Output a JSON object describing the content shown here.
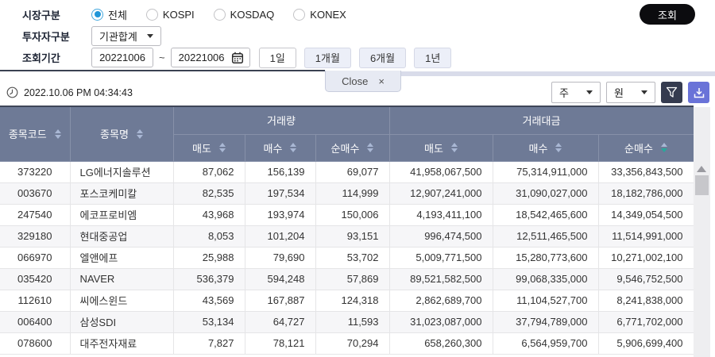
{
  "form": {
    "market": {
      "label": "시장구분",
      "options": [
        {
          "label": "전체",
          "selected": true
        },
        {
          "label": "KOSPI",
          "selected": false
        },
        {
          "label": "KOSDAQ",
          "selected": false
        },
        {
          "label": "KONEX",
          "selected": false
        }
      ]
    },
    "investor": {
      "label": "투자자구분",
      "value": "기관합계"
    },
    "period": {
      "label": "조회기간",
      "from": "20221006",
      "tilde": "~",
      "to": "20221006",
      "ranges": [
        "1일",
        "1개월",
        "6개월",
        "1년"
      ],
      "selected_range": "1일"
    },
    "search_button": "조회"
  },
  "tab": {
    "label": "Close",
    "close": "×"
  },
  "toolbar": {
    "timestamp": "2022.10.06 PM 04:34:43",
    "unit_period": "주",
    "unit_currency": "원"
  },
  "table": {
    "header": {
      "code": "종목코드",
      "name": "종목명",
      "volume_group": "거래량",
      "value_group": "거래대금",
      "sell": "매도",
      "buy": "매수",
      "net": "순매수"
    },
    "rows": [
      [
        "373220",
        "LG에너지솔루션",
        "87,062",
        "156,139",
        "69,077",
        "41,958,067,500",
        "75,314,911,000",
        "33,356,843,500"
      ],
      [
        "003670",
        "포스코케미칼",
        "82,535",
        "197,534",
        "114,999",
        "12,907,241,000",
        "31,090,027,000",
        "18,182,786,000"
      ],
      [
        "247540",
        "에코프로비엠",
        "43,968",
        "193,974",
        "150,006",
        "4,193,411,100",
        "18,542,465,600",
        "14,349,054,500"
      ],
      [
        "329180",
        "현대중공업",
        "8,053",
        "101,204",
        "93,151",
        "996,474,500",
        "12,511,465,500",
        "11,514,991,000"
      ],
      [
        "066970",
        "엘앤에프",
        "25,988",
        "79,690",
        "53,702",
        "5,009,771,500",
        "15,280,773,600",
        "10,271,002,100"
      ],
      [
        "035420",
        "NAVER",
        "536,379",
        "594,248",
        "57,869",
        "89,521,582,500",
        "99,068,335,000",
        "9,546,752,500"
      ],
      [
        "112610",
        "씨에스윈드",
        "43,569",
        "167,887",
        "124,318",
        "2,862,689,700",
        "11,104,527,700",
        "8,241,838,000"
      ],
      [
        "006400",
        "삼성SDI",
        "53,134",
        "64,727",
        "11,593",
        "31,023,087,000",
        "37,794,789,000",
        "6,771,702,000"
      ],
      [
        "078600",
        "대주전자재료",
        "7,827",
        "78,121",
        "70,294",
        "658,260,300",
        "6,564,959,700",
        "5,906,699,400"
      ]
    ]
  },
  "colors": {
    "header_bg": "#6e7a96",
    "sort_arrow": "#a9b7d4",
    "sort_active": "#29a79b",
    "radio_selected": "#2196d8",
    "filter_button": "#353b4f",
    "download_button": "#6a73d8",
    "search_button": "#0c0c0f",
    "tab_bg": "#e7eaf3"
  }
}
